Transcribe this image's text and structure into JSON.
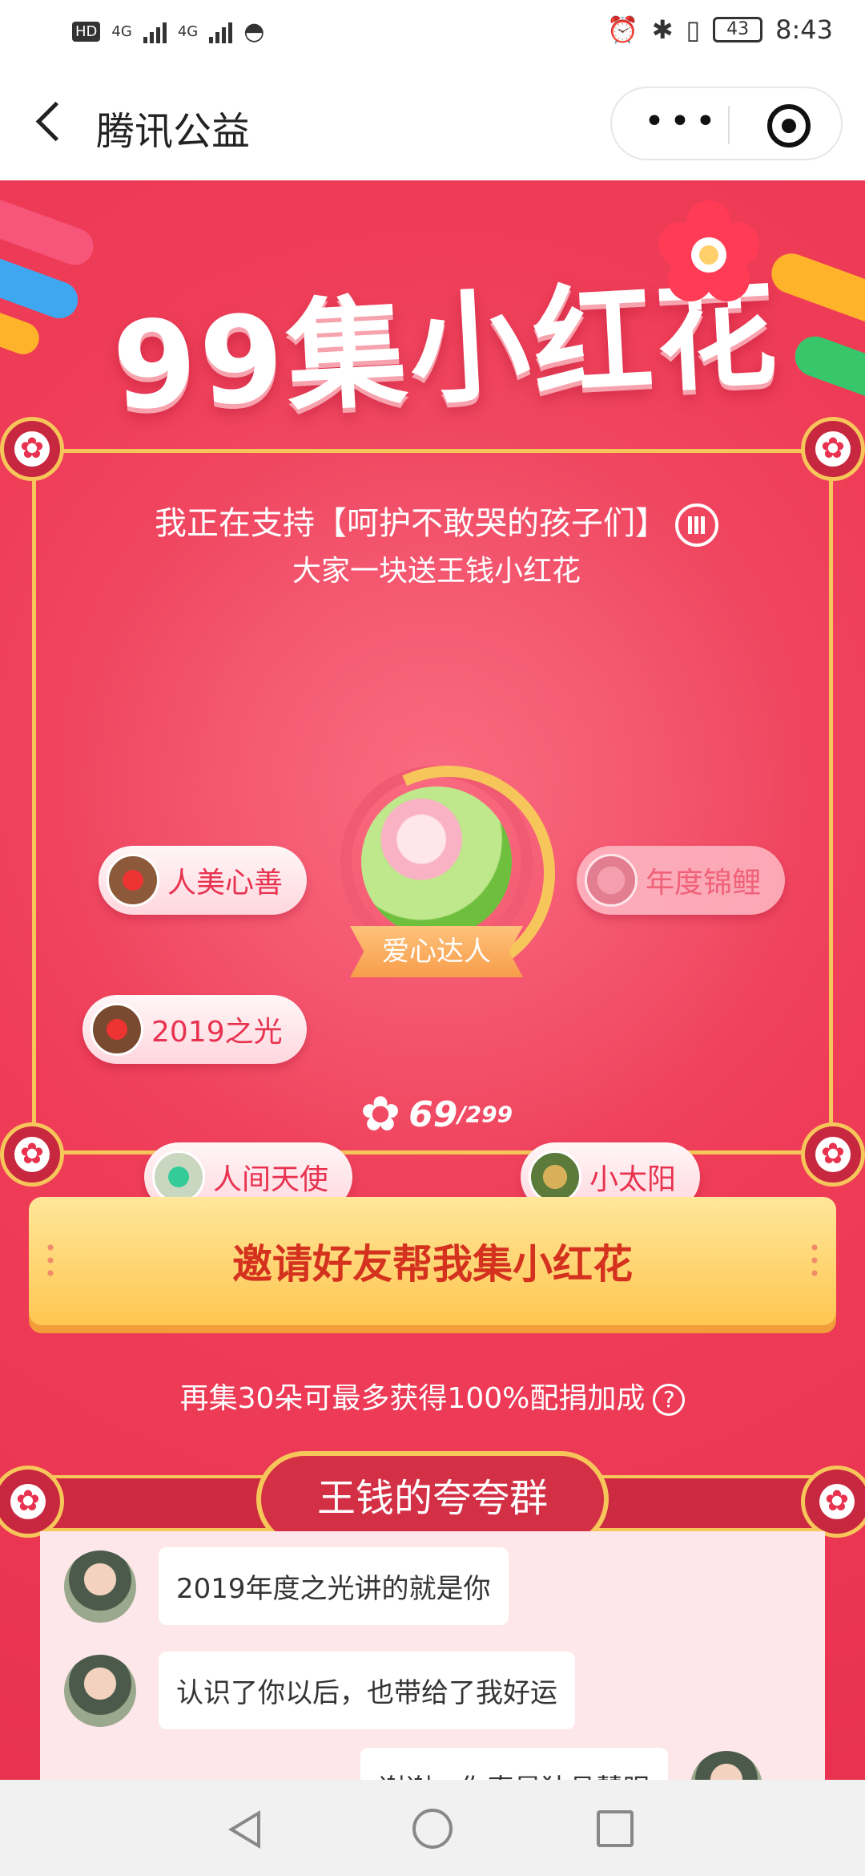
{
  "status_bar": {
    "left_labels": [
      "HD",
      "4G",
      "4G"
    ],
    "battery": "43",
    "time": "8:43"
  },
  "header": {
    "title": "腾讯公益",
    "menu_label": "•••"
  },
  "banner": {
    "title": "99集小红花"
  },
  "card": {
    "title": "我正在支持【呵护不敢哭的孩子们】",
    "subtitle": "大家一块送王钱小红花",
    "tags": [
      {
        "label": "人美心善"
      },
      {
        "label": "年度锦鲤"
      },
      {
        "label": "2019之光"
      },
      {
        "label": "人间天使"
      },
      {
        "label": "小太阳"
      }
    ],
    "center_badge": "爱心达人",
    "count": "69",
    "total": "/299",
    "progress": 0.23
  },
  "invite_button": "邀请好友帮我集小红花",
  "tip": "再集30朵可最多获得100%配捐加成",
  "group": {
    "title": "王钱的夸夸群",
    "messages": [
      {
        "text": "2019年度之光讲的就是你"
      },
      {
        "text": "认识了你以后，也带给了我好运"
      },
      {
        "text": "谢谢，你真是独具慧眼"
      }
    ]
  },
  "colors": {
    "background": "#ef3f5a",
    "gold": "#f7c65a",
    "button": "#ffc651",
    "button_text": "#d4321f"
  }
}
